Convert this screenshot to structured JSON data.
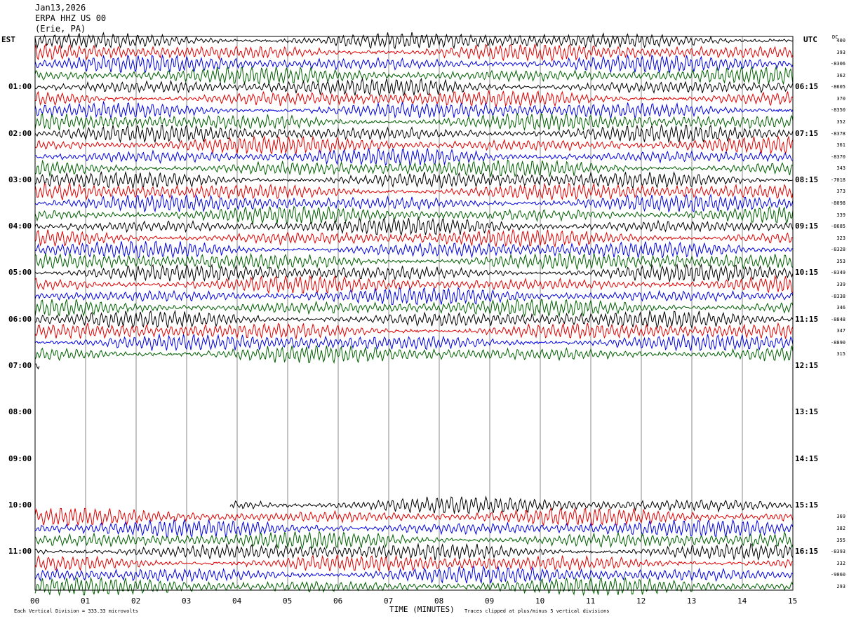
{
  "header": {
    "date": "Jan13,2026",
    "station": "ERPA HHZ US 00",
    "location": "(Erie, PA)"
  },
  "labels": {
    "left_tz": "EST",
    "right_tz": "UTC",
    "dc": "DC",
    "xlabel": "TIME (MINUTES)",
    "scale_note": "Each Vertical Division =  333.33 microvolts",
    "clip_note": "Traces clipped at plus/minus 5 vertical divisions"
  },
  "chart_data": {
    "type": "line",
    "title": "",
    "xlabel": "TIME (MINUTES)",
    "xlim": [
      0,
      15
    ],
    "x_ticks": [
      "00",
      "01",
      "02",
      "03",
      "04",
      "05",
      "06",
      "07",
      "08",
      "09",
      "10",
      "11",
      "12",
      "13",
      "14",
      "15"
    ],
    "left_hour_labels": [
      "01:00",
      "02:00",
      "03:00",
      "04:00",
      "05:00",
      "06:00",
      "07:00",
      "08:00",
      "09:00",
      "10:00",
      "11:00"
    ],
    "right_hour_labels": [
      "06:15",
      "07:15",
      "08:15",
      "09:15",
      "10:15",
      "11:15",
      "12:15",
      "13:15",
      "14:15",
      "15:15",
      "16:15"
    ],
    "trace_colors": [
      "#000000",
      "#e00000",
      "#0000e0",
      "#006000"
    ],
    "rows_per_hour": 4,
    "total_rows": 48,
    "segment_1": {
      "start_row": 0,
      "end_row": 28,
      "dc_labels": [
        "400",
        "393",
        "-8306",
        "362",
        "-8605",
        "370",
        "-8350",
        "352",
        "-8378",
        "361",
        "-8370",
        "343",
        "-7018",
        "373",
        "-8098",
        "339",
        "-8685",
        "323",
        "-8328",
        "353",
        "-8349",
        "339",
        "-8338",
        "346",
        "-8848",
        "347",
        "-8890",
        "315"
      ]
    },
    "segment_2": {
      "start_row": 40,
      "end_row": 48,
      "dc_labels": [
        "",
        "369",
        "382",
        "355",
        "-8393",
        "332",
        "-9060",
        "293"
      ]
    }
  }
}
